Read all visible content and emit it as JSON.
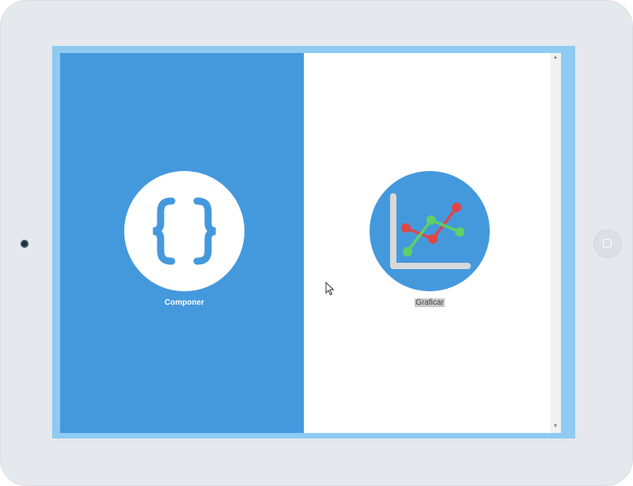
{
  "apps": [
    {
      "label": "Componer",
      "icon": "code-braces-icon",
      "background": "#4499dd",
      "circle_color": "#ffffff",
      "accent": "#4499dd"
    },
    {
      "label": "Graficar",
      "icon": "line-chart-icon",
      "background": "#ffffff",
      "circle_color": "#4499dd",
      "accent_red": "#e04646",
      "accent_green": "#5fd065"
    }
  ],
  "scrollbar": {
    "up_arrow": "▲",
    "down_arrow": "▼"
  },
  "device": {
    "bezel_color": "#e5e8ec",
    "screen_border_color": "#8ecbf4"
  }
}
